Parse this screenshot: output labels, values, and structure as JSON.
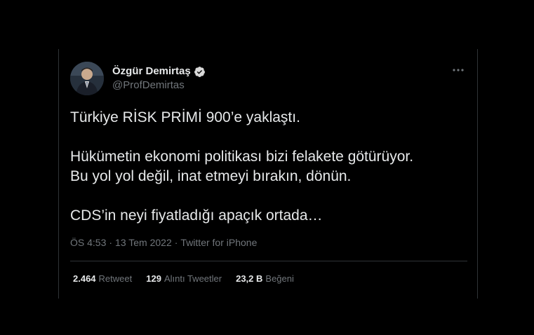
{
  "author": {
    "name": "Özgür Demirtaş",
    "handle": "@ProfDemirtas",
    "verified": true,
    "avatar_icon": "profile-photo"
  },
  "tweet": {
    "paragraphs": [
      "Türkiye RİSK PRİMİ 900’e yaklaştı.",
      "Hükümetin ekonomi politikası bizi felakete götürüyor.\nBu yol yol değil, inat etmeyi bırakın, dönün.",
      "CDS’in neyi fiyatladığı apaçık ortada…"
    ]
  },
  "meta": {
    "time": "ÖS 4:53",
    "sep1": "·",
    "date": "13 Tem 2022",
    "sep2": "·",
    "source": "Twitter for iPhone"
  },
  "stats": {
    "retweets": {
      "count": "2.464",
      "label": "Retweet"
    },
    "quotes": {
      "count": "129",
      "label": "Alıntı Tweetler"
    },
    "likes": {
      "count": "23,2 B",
      "label": "Beğeni"
    }
  },
  "colors": {
    "background": "#000000",
    "text_primary": "#e7e9ea",
    "text_secondary": "#71767b",
    "border": "#2f3336",
    "verified_badge": "#d9d9d9"
  },
  "icons": {
    "more": "more-horizontal-icon",
    "verified": "verified-badge-icon"
  }
}
